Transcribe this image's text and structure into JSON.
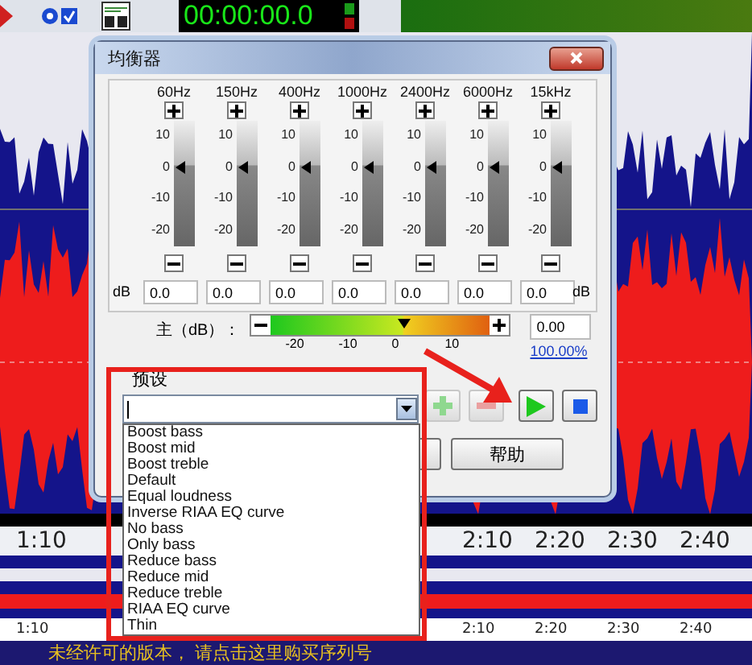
{
  "toolbar": {
    "timer": "00:00:00.0"
  },
  "dialog": {
    "title": "均衡器",
    "bands": [
      {
        "freq": "60Hz",
        "scale": [
          "10",
          "0",
          "-10",
          "-20"
        ],
        "level": 0.63,
        "value": "0.0"
      },
      {
        "freq": "150Hz",
        "scale": [
          "10",
          "0",
          "-10",
          "-20"
        ],
        "level": 0.63,
        "value": "0.0"
      },
      {
        "freq": "400Hz",
        "scale": [
          "10",
          "0",
          "-10",
          "-20"
        ],
        "level": 0.63,
        "value": "0.0"
      },
      {
        "freq": "1000Hz",
        "scale": [
          "10",
          "0",
          "-10",
          "-20"
        ],
        "level": 0.63,
        "value": "0.0"
      },
      {
        "freq": "2400Hz",
        "scale": [
          "10",
          "0",
          "-10",
          "-20"
        ],
        "level": 0.63,
        "value": "0.0"
      },
      {
        "freq": "6000Hz",
        "scale": [
          "10",
          "0",
          "-10",
          "-20"
        ],
        "level": 0.63,
        "value": "0.0"
      },
      {
        "freq": "15kHz",
        "scale": [
          "10",
          "0",
          "-10",
          "-20"
        ],
        "level": 0.63,
        "value": "0.0"
      }
    ],
    "unit_left": "dB",
    "unit_right": "dB",
    "master": {
      "label": "主（dB）：",
      "level": 0.61,
      "ticks": [
        "-20",
        "-10",
        "0",
        "10"
      ],
      "value": "0.00",
      "percent": "100.00%"
    },
    "preset": {
      "label": "预设",
      "items": [
        "Boost bass",
        "Boost mid",
        "Boost treble",
        "Default",
        "Equal loudness",
        "Inverse RIAA EQ curve",
        "No bass",
        "Only bass",
        "Reduce bass",
        "Reduce mid",
        "Reduce treble",
        "RIAA EQ curve",
        "Thin"
      ]
    },
    "help_button": "帮助"
  },
  "ruler": [
    "1:10",
    "2:10",
    "2:20",
    "2:30",
    "2:40"
  ],
  "overview_ruler": [
    "1:10",
    "2:10",
    "2:20",
    "2:30",
    "2:40"
  ],
  "status": "未经许可的版本，  请点击这里购买序列号"
}
